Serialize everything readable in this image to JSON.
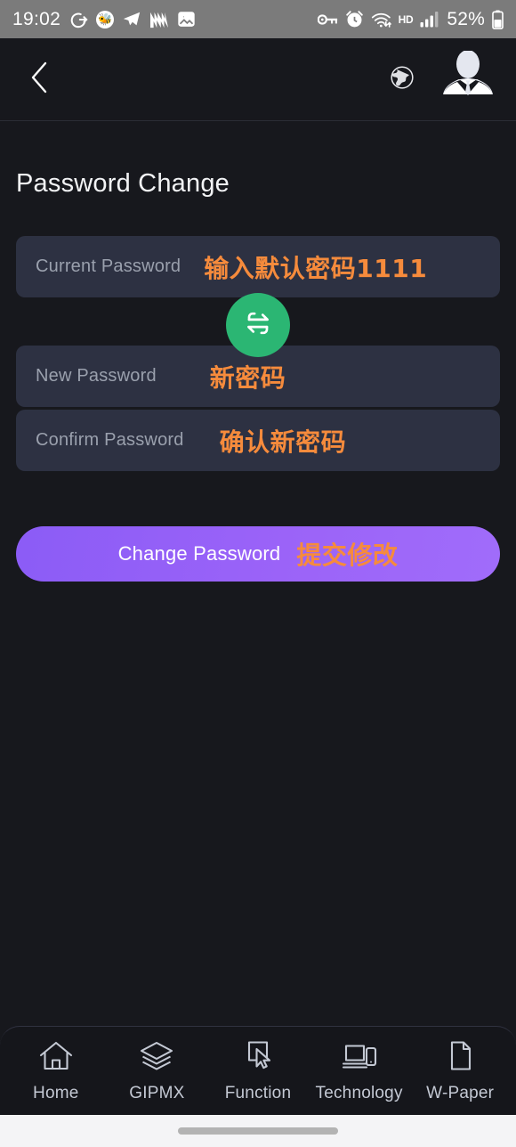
{
  "statusbar": {
    "time": "19:02",
    "battery_percent": "52%",
    "network_label": "HD",
    "left_icons": [
      "rotate-exit-icon",
      "bee-emoji-icon",
      "telegram-icon",
      "n-logo-icon",
      "photos-icon"
    ],
    "right_icons": [
      "vpn-key-icon",
      "alarm-icon",
      "wifi-icon",
      "signal-icon",
      "battery-icon"
    ],
    "bee_glyph": "🐝"
  },
  "header": {
    "back_icon": "chevron-left-icon",
    "globe_icon": "globe-icon",
    "avatar_icon": "user-avatar-businessman"
  },
  "page": {
    "title": "Password Change"
  },
  "fields": [
    {
      "name": "current-password",
      "placeholder": "Current Password",
      "value": "",
      "annotation": "输入默认密码1111"
    },
    {
      "name": "new-password",
      "placeholder": "New Password",
      "value": "",
      "annotation": "新密码"
    },
    {
      "name": "confirm-password",
      "placeholder": "Confirm Password",
      "value": "",
      "annotation": "确认新密码"
    }
  ],
  "swap_button": {
    "icon": "swap-arrows-icon"
  },
  "submit": {
    "label": "Change Password",
    "annotation": "提交修改"
  },
  "bottomnav": [
    {
      "label": "Home",
      "icon": "home-icon"
    },
    {
      "label": "GIPMX",
      "icon": "layers-icon"
    },
    {
      "label": "Function",
      "icon": "cursor-select-icon"
    },
    {
      "label": "Technology",
      "icon": "laptop-phone-icon"
    },
    {
      "label": "W-Paper",
      "icon": "document-icon"
    }
  ],
  "colors": {
    "background": "#17181d",
    "field_bg": "#2d3142",
    "accent_purple": "#9b63f8",
    "accent_green": "#2bb673",
    "annotation_orange": "#f68b3c",
    "statusbar_bg": "#7b7b7b"
  }
}
